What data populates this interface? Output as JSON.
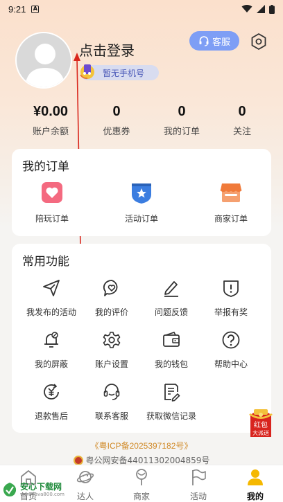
{
  "status_bar": {
    "time": "9:21",
    "notif_letter": "A"
  },
  "profile": {
    "login_text": "点击登录",
    "phone_text": "暂无手机号",
    "service_label": "客服"
  },
  "stats": [
    {
      "value": "¥0.00",
      "label": "账户余额"
    },
    {
      "value": "0",
      "label": "优惠券"
    },
    {
      "value": "0",
      "label": "我的订单"
    },
    {
      "value": "0",
      "label": "关注"
    }
  ],
  "orders": {
    "title": "我的订单",
    "items": [
      {
        "label": "陪玩订单",
        "icon": "heart-icon",
        "color": "#f0536a"
      },
      {
        "label": "活动订单",
        "icon": "star-shield-icon",
        "color": "#3b7de0"
      },
      {
        "label": "商家订单",
        "icon": "shop-icon",
        "color": "#f07a3a"
      }
    ]
  },
  "functions": {
    "title": "常用功能",
    "items": [
      {
        "label": "我发布的活动",
        "icon": "send-icon"
      },
      {
        "label": "我的评价",
        "icon": "chat-heart-icon"
      },
      {
        "label": "问题反馈",
        "icon": "pen-icon"
      },
      {
        "label": "举报有奖",
        "icon": "alert-shield-icon"
      },
      {
        "label": "我的屏蔽",
        "icon": "bell-off-icon"
      },
      {
        "label": "账户设置",
        "icon": "gear-icon"
      },
      {
        "label": "我的钱包",
        "icon": "wallet-icon"
      },
      {
        "label": "帮助中心",
        "icon": "help-icon"
      },
      {
        "label": "退款售后",
        "icon": "refund-icon"
      },
      {
        "label": "联系客服",
        "icon": "headset-icon"
      },
      {
        "label": "获取微信记录",
        "icon": "document-icon"
      }
    ]
  },
  "red_packet": {
    "line1": "红包",
    "line2": "大派送"
  },
  "footer": {
    "icp": "《粤ICP备2025397182号》",
    "police": "粤公网安备44011302004859号"
  },
  "tabs": [
    {
      "label": "首页",
      "icon": "home-icon"
    },
    {
      "label": "达人",
      "icon": "planet-icon"
    },
    {
      "label": "商家",
      "icon": "lollipop-icon"
    },
    {
      "label": "活动",
      "icon": "flag-icon"
    },
    {
      "label": "我的",
      "icon": "person-icon",
      "active": true
    }
  ],
  "watermark": {
    "title": "安心下载网",
    "url": "www.java800.com"
  },
  "colors": {
    "accent": "#7e9ef5",
    "icp": "#d18b2a",
    "active_tab": "#f5b800"
  }
}
